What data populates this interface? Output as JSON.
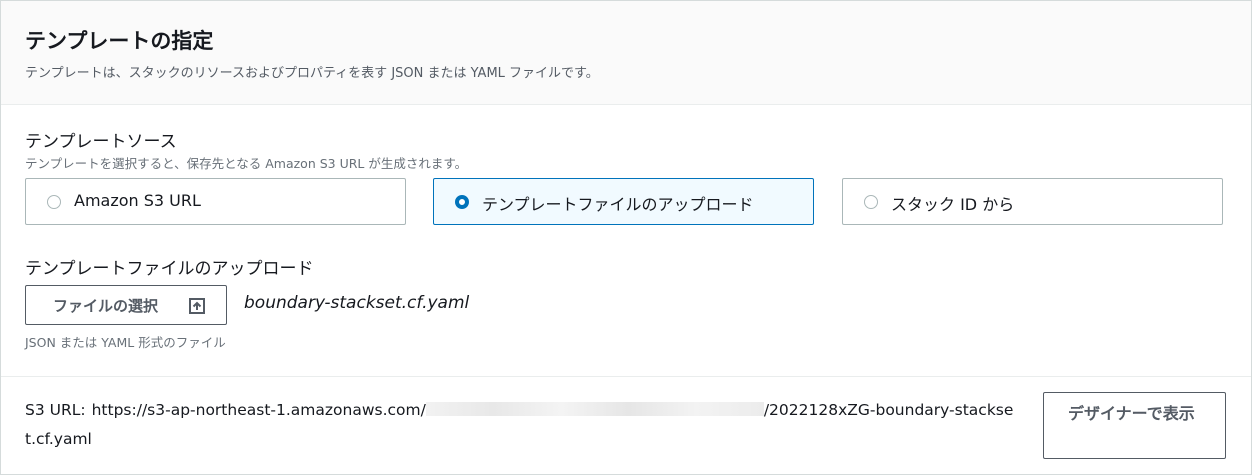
{
  "header": {
    "title": "テンプレートの指定",
    "description": "テンプレートは、スタックのリソースおよびプロパティを表す JSON または YAML ファイルです。"
  },
  "template_source": {
    "label": "テンプレートソース",
    "description": "テンプレートを選択すると、保存先となる Amazon S3 URL が生成されます。",
    "options": [
      {
        "label": "Amazon S3 URL",
        "selected": false
      },
      {
        "label": "テンプレートファイルのアップロード",
        "selected": true
      },
      {
        "label": "スタック ID から",
        "selected": false
      }
    ]
  },
  "upload": {
    "label": "テンプレートファイルのアップロード",
    "choose_button_label": "ファイルの選択",
    "choose_button_icon": "upload-icon",
    "file_name": "boundary-stackset.cf.yaml",
    "hint": "JSON または YAML 形式のファイル"
  },
  "s3": {
    "label": "S3 URL:",
    "url_prefix": "https://s3-ap-northeast-1.amazonaws.com/",
    "url_suffix": "/2022128xZG-boundary-stackse",
    "url_continued": "t.cf.yaml"
  },
  "designer_button_label": "デザイナーで表示",
  "colors": {
    "accent": "#0073bb",
    "selected_tile_bg": "#f1faff",
    "header_bg": "#fafafa",
    "border": "#aab7b8"
  }
}
